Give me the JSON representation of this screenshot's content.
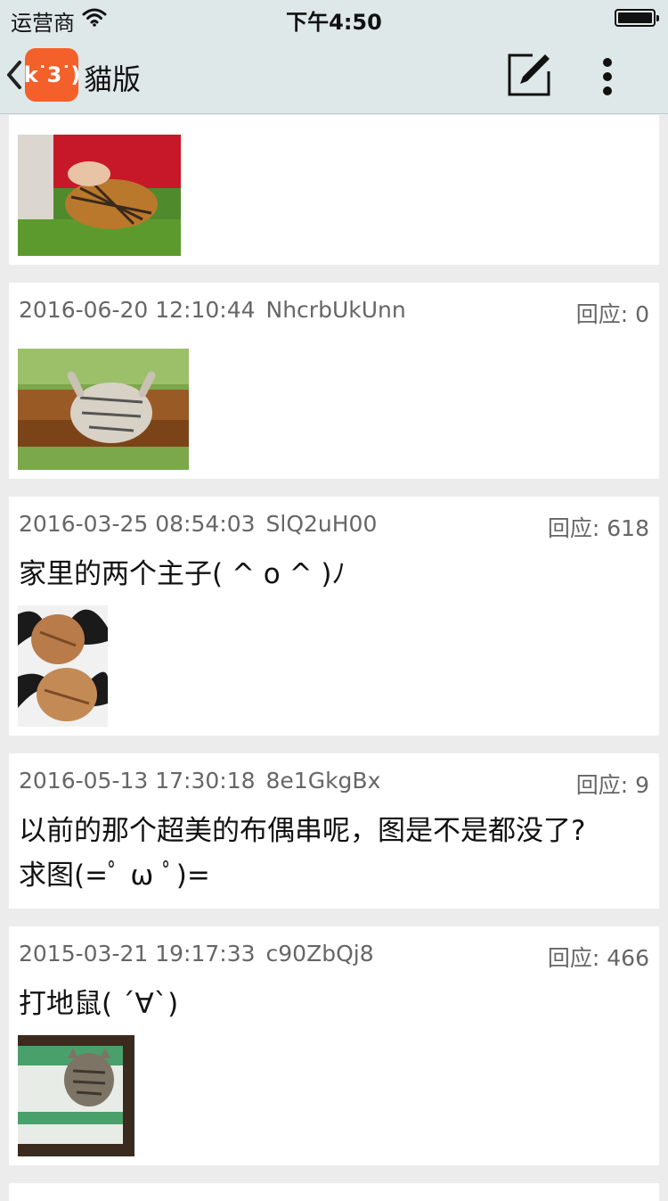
{
  "status_bar": {
    "carrier": "运营商",
    "time": "下午4:50"
  },
  "nav": {
    "logo_text": "k˙3˙)",
    "title": "貓版"
  },
  "posts": [
    {
      "date": "",
      "uid": "",
      "replies": "",
      "content": ""
    },
    {
      "date": "2016-06-20 12:10:44",
      "uid": "NhcrbUkUnn",
      "replies": "回应: 0",
      "content": ""
    },
    {
      "date": "2016-03-25 08:54:03",
      "uid": "SlQ2uH00",
      "replies": "回应: 618",
      "content": "家里的两个主子( ^ o ^ )ﾉ"
    },
    {
      "date": "2016-05-13 17:30:18",
      "uid": "8e1GkgBx",
      "replies": "回应: 9",
      "content_lines": [
        "以前的那个超美的布偶串呢，图是不是都没了?",
        "求图(=ﾟ ω ﾟ)="
      ]
    },
    {
      "date": "2015-03-21 19:17:33",
      "uid": "c90ZbQj8",
      "replies": "回应: 466",
      "content": "打地鼠( ´∀`)"
    }
  ],
  "colors": {
    "bar_bg": "#dfe8e9",
    "feed_bg": "#ececec",
    "logo": "#f4602a",
    "meta": "#666666"
  }
}
